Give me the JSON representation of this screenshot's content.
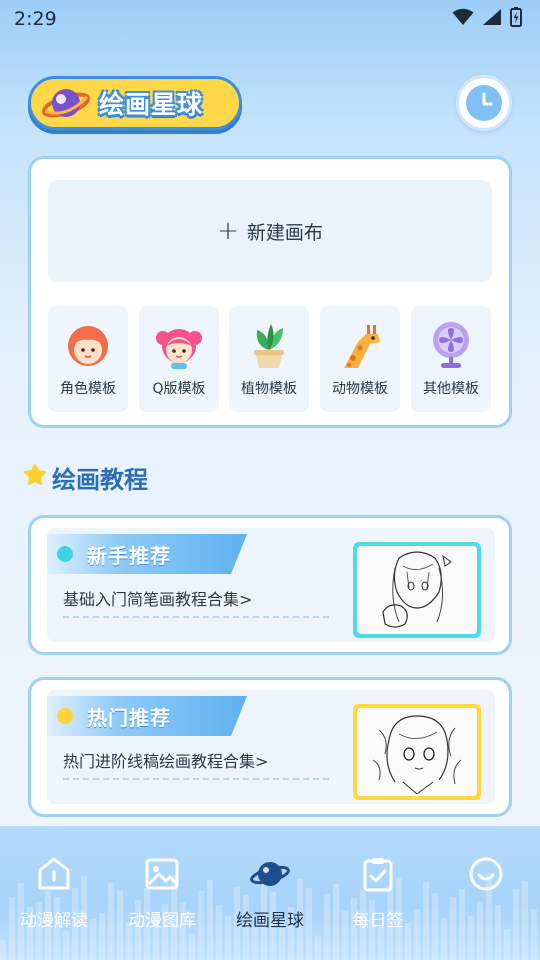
{
  "status_bar": {
    "time": "2:29"
  },
  "header": {
    "title": "绘画星球"
  },
  "canvas": {
    "new_label": "新建画布"
  },
  "templates": [
    {
      "label": "角色模板",
      "icon": "girl-face-icon"
    },
    {
      "label": "Q版模板",
      "icon": "chibi-face-icon"
    },
    {
      "label": "植物模板",
      "icon": "potted-plant-icon"
    },
    {
      "label": "动物模板",
      "icon": "giraffe-icon"
    },
    {
      "label": "其他模板",
      "icon": "fan-icon"
    }
  ],
  "section": {
    "title": "绘画教程"
  },
  "tutorials": [
    {
      "tag": "新手推荐",
      "link": "基础入门简笔画教程合集>",
      "dot": "#3fd2e6",
      "frame": "#4fdce9"
    },
    {
      "tag": "热门推荐",
      "link": "热门进阶线稿绘画教程合集>",
      "dot": "#ffd43a",
      "frame": "#ffd83f"
    }
  ],
  "nav": {
    "items": [
      {
        "label": "动漫解读",
        "icon": "home-icon",
        "active": false
      },
      {
        "label": "动漫图库",
        "icon": "image-icon",
        "active": false
      },
      {
        "label": "绘画星球",
        "icon": "planet-icon",
        "active": true
      },
      {
        "label": "每日签",
        "icon": "clipboard-check-icon",
        "active": false
      },
      {
        "label": "",
        "icon": "smile-icon",
        "active": false
      }
    ]
  }
}
